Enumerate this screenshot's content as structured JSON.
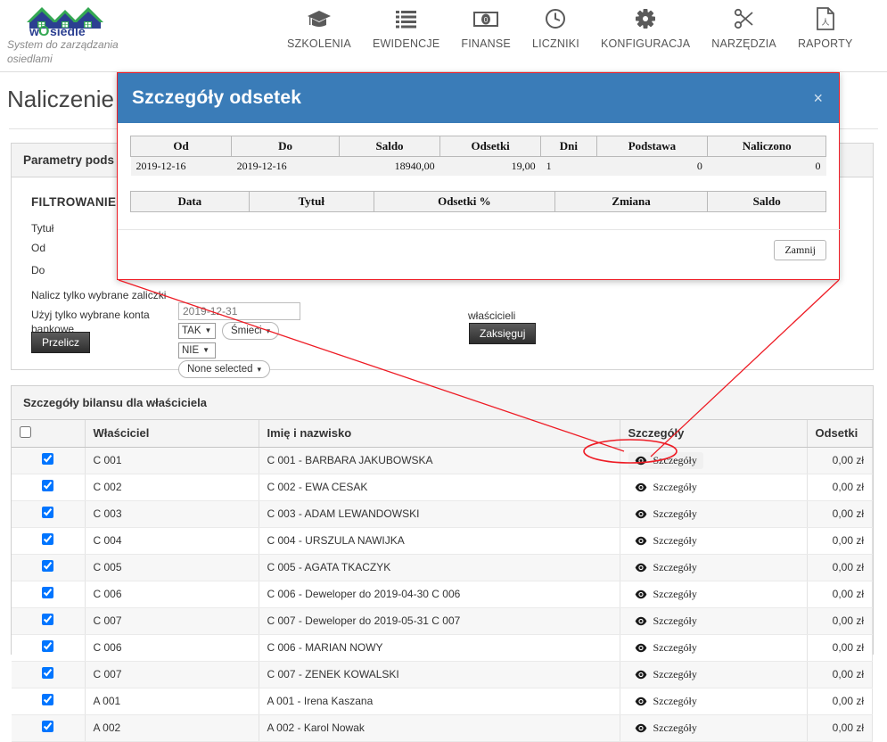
{
  "brand": {
    "name": "wOsiedle",
    "tagline": "System do zarządzania osiedlami",
    "logo_icon": "houses-logo-icon"
  },
  "nav": {
    "items": [
      {
        "label": "SZKOLENIA",
        "icon": "graduation-cap-icon"
      },
      {
        "label": "EWIDENCJE",
        "icon": "list-icon"
      },
      {
        "label": "FINANSE",
        "icon": "banknote-icon"
      },
      {
        "label": "LICZNIKI",
        "icon": "clock-icon"
      },
      {
        "label": "KONFIGURACJA",
        "icon": "gear-icon"
      },
      {
        "label": "NARZĘDZIA",
        "icon": "scissors-icon"
      },
      {
        "label": "RAPORTY",
        "icon": "pdf-file-icon"
      }
    ]
  },
  "page": {
    "title": "Naliczenie"
  },
  "params_panel": {
    "header": "Parametry pods",
    "filter_heading": "FILTROWANIE",
    "labels": {
      "tytul": "Tytuł",
      "od": "Od",
      "do": "Do",
      "nalicz": "Nalicz tylko wybrane zaliczki",
      "uzyj": "Użyj tylko wybrane konta bankowe",
      "wlascicieli": "właścicieli"
    },
    "date_input_value": "2019-12-31",
    "select_nalicz": "TAK",
    "select_uzyj": "NIE",
    "dropdown_smieci": "Śmieci",
    "dropdown_none": "None selected",
    "btn_przelicz": "Przelicz",
    "btn_zaksieguj": "Zaksięguj"
  },
  "modal": {
    "title": "Szczegóły odsetek",
    "close_icon": "close-icon",
    "close_label": "×",
    "table1": {
      "headers": [
        "Od",
        "Do",
        "Saldo",
        "Odsetki",
        "Dni",
        "Podstawa",
        "Naliczono"
      ],
      "rows": [
        [
          "2019-12-16",
          "2019-12-16",
          "18940,00",
          "19,00",
          "1",
          "0",
          "0"
        ]
      ]
    },
    "table2": {
      "headers": [
        "Data",
        "Tytuł",
        "Odsetki %",
        "Zmiana",
        "Saldo"
      ],
      "rows": []
    },
    "btn_close": "Zamnij",
    "border_color": "#ee1c25",
    "header_color": "#3a7cb8"
  },
  "balance_panel": {
    "header": "Szczegóły bilansu dla właściciela",
    "columns": [
      "",
      "Właściciel",
      "Imię i nazwisko",
      "Szczegóły",
      "Odsetki"
    ],
    "select_all_checked": false,
    "detail_link_label": "Szczegóły",
    "detail_icon": "eye-icon",
    "rows": [
      {
        "checked": true,
        "owner": "C 001",
        "name": "C 001 - BARBARA JAKUBOWSKA",
        "details": "Szczegóły",
        "odsetki": "0,00 zł",
        "highlighted": true
      },
      {
        "checked": true,
        "owner": "C 002",
        "name": "C 002 - EWA CESAK",
        "details": "Szczegóły",
        "odsetki": "0,00 zł",
        "highlighted": false
      },
      {
        "checked": true,
        "owner": "C 003",
        "name": "C 003 - ADAM LEWANDOWSKI",
        "details": "Szczegóły",
        "odsetki": "0,00 zł",
        "highlighted": false
      },
      {
        "checked": true,
        "owner": "C 004",
        "name": "C 004 - URSZULA NAWIJKA",
        "details": "Szczegóły",
        "odsetki": "0,00 zł",
        "highlighted": false
      },
      {
        "checked": true,
        "owner": "C 005",
        "name": "C 005 - AGATA TKACZYK",
        "details": "Szczegóły",
        "odsetki": "0,00 zł",
        "highlighted": false
      },
      {
        "checked": true,
        "owner": "C 006",
        "name": "C 006 - Deweloper do 2019-04-30 C 006",
        "details": "Szczegóły",
        "odsetki": "0,00 zł",
        "highlighted": false
      },
      {
        "checked": true,
        "owner": "C 007",
        "name": "C 007 - Deweloper do 2019-05-31 C 007",
        "details": "Szczegóły",
        "odsetki": "0,00 zł",
        "highlighted": false
      },
      {
        "checked": true,
        "owner": "C 006",
        "name": "C 006 - MARIAN NOWY",
        "details": "Szczegóły",
        "odsetki": "0,00 zł",
        "highlighted": false
      },
      {
        "checked": true,
        "owner": "C 007",
        "name": "C 007 - ZENEK KOWALSKI",
        "details": "Szczegóły",
        "odsetki": "0,00 zł",
        "highlighted": false
      },
      {
        "checked": true,
        "owner": "A 001",
        "name": "A 001 - Irena Kaszana",
        "details": "Szczegóły",
        "odsetki": "0,00 zł",
        "highlighted": false
      },
      {
        "checked": true,
        "owner": "A 002",
        "name": "A 002 - Karol Nowak",
        "details": "Szczegóły",
        "odsetki": "0,00 zł",
        "highlighted": false
      }
    ]
  },
  "annotation": {
    "color": "#ee1c25",
    "ellipse_target": "szczegoly-link-row-1"
  }
}
